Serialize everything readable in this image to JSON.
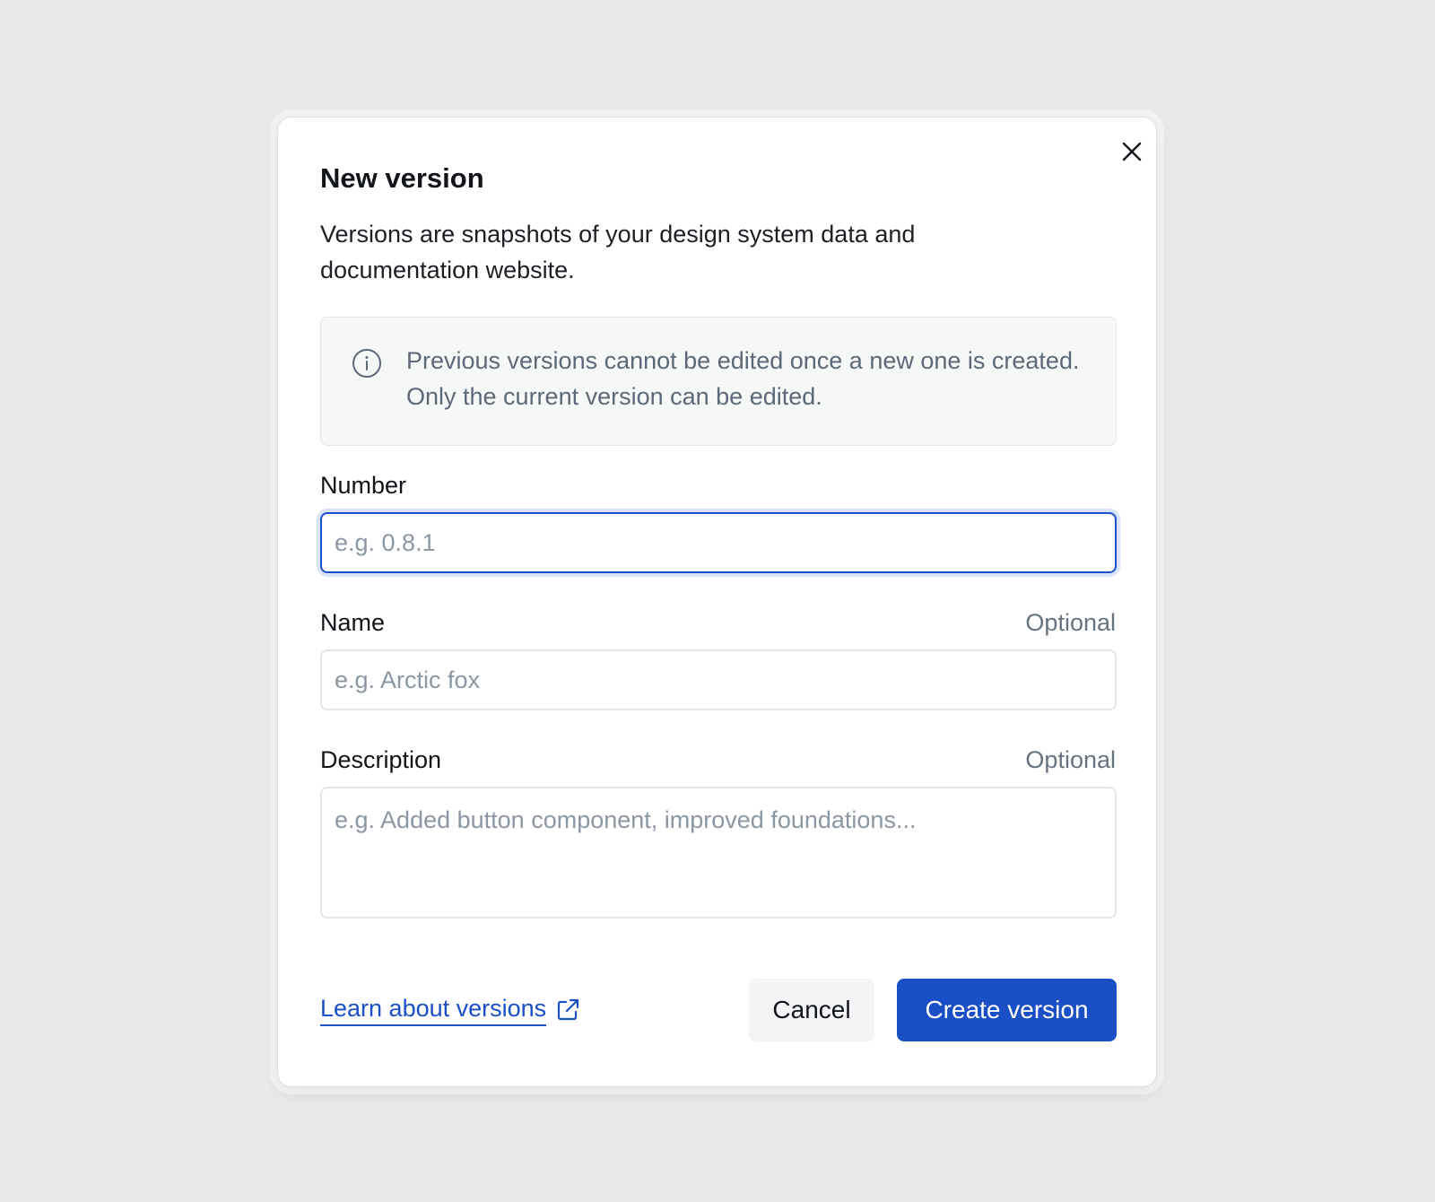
{
  "dialog": {
    "title": "New version",
    "description": "Versions are snapshots of your design system data and documentation website.",
    "close_icon": "close-icon"
  },
  "info": {
    "icon": "info-icon",
    "text": "Previous versions cannot be edited once a new one is created. Only the current version can be edited."
  },
  "fields": {
    "number": {
      "label": "Number",
      "placeholder": "e.g. 0.8.1",
      "value": ""
    },
    "name": {
      "label": "Name",
      "optional": "Optional",
      "placeholder": "e.g. Arctic fox",
      "value": ""
    },
    "description": {
      "label": "Description",
      "optional": "Optional",
      "placeholder": "e.g. Added button component, improved foundations...",
      "value": ""
    }
  },
  "footer": {
    "learn_link": "Learn about versions",
    "learn_link_icon": "external-link-icon",
    "cancel_label": "Cancel",
    "create_label": "Create version"
  },
  "colors": {
    "primary": "#1a4fc6",
    "focus_ring": "#d7e3fb",
    "muted_text": "#5d6878"
  }
}
